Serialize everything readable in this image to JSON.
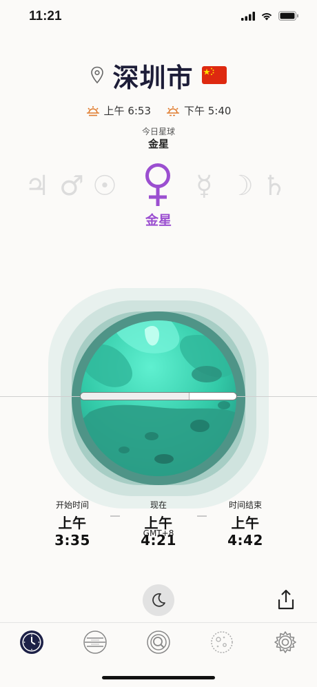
{
  "status_bar": {
    "time": "11:21"
  },
  "header": {
    "city": "深圳市"
  },
  "sun": {
    "sunrise": "上午 6:53",
    "sunset": "下午 5:40"
  },
  "today_planet": {
    "label": "今日星球",
    "value": "金星"
  },
  "planets": {
    "sequence": [
      "♃",
      "♂",
      "☉",
      "♀",
      "☿",
      "☽",
      "♄"
    ],
    "current_name": "金星"
  },
  "hour_progress": 0.7,
  "times": {
    "start_label": "开始时间",
    "start_value": "上午 3:35",
    "now_label": "现在",
    "now_value": "上午 4:21",
    "end_label": "时间结束",
    "end_value": "上午 4:42",
    "timezone": "GMT+8"
  },
  "tabs": [
    {
      "name": "clock"
    },
    {
      "name": "lines"
    },
    {
      "name": "search-planet"
    },
    {
      "name": "moon"
    },
    {
      "name": "settings"
    }
  ],
  "colors": {
    "accent_purple": "#9b4fd0",
    "orb_teal": "#3fd6b5"
  }
}
